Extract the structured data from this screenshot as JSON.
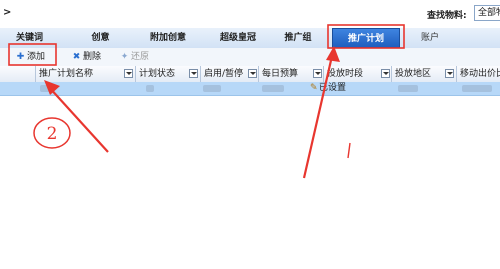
{
  "header": {
    "collapse_glyph": ">",
    "search_label": "查找物料:",
    "search_value": "全部物"
  },
  "tabs": [
    {
      "label": "关键词"
    },
    {
      "label": "创意"
    },
    {
      "label": "附加创意"
    },
    {
      "label": "超级皇冠"
    },
    {
      "label": "推广组"
    },
    {
      "label": "推广计划"
    },
    {
      "label": "账户"
    }
  ],
  "toolbar": {
    "add": "添加",
    "delete": "删除",
    "restore": "还原"
  },
  "grid": {
    "columns": [
      "推广计划名称",
      "计划状态",
      "启用/暂停",
      "每日预算",
      "投放时段",
      "投放地区",
      "移动出价比"
    ],
    "row": {
      "schedule": "已设置"
    }
  },
  "annotation": {
    "circle_label": "2"
  },
  "colors": {
    "active_tab": "#2a6fd0",
    "highlight_box": "#e8362f",
    "arrow": "#e8362f",
    "selected_row": "#b7d8f8"
  }
}
